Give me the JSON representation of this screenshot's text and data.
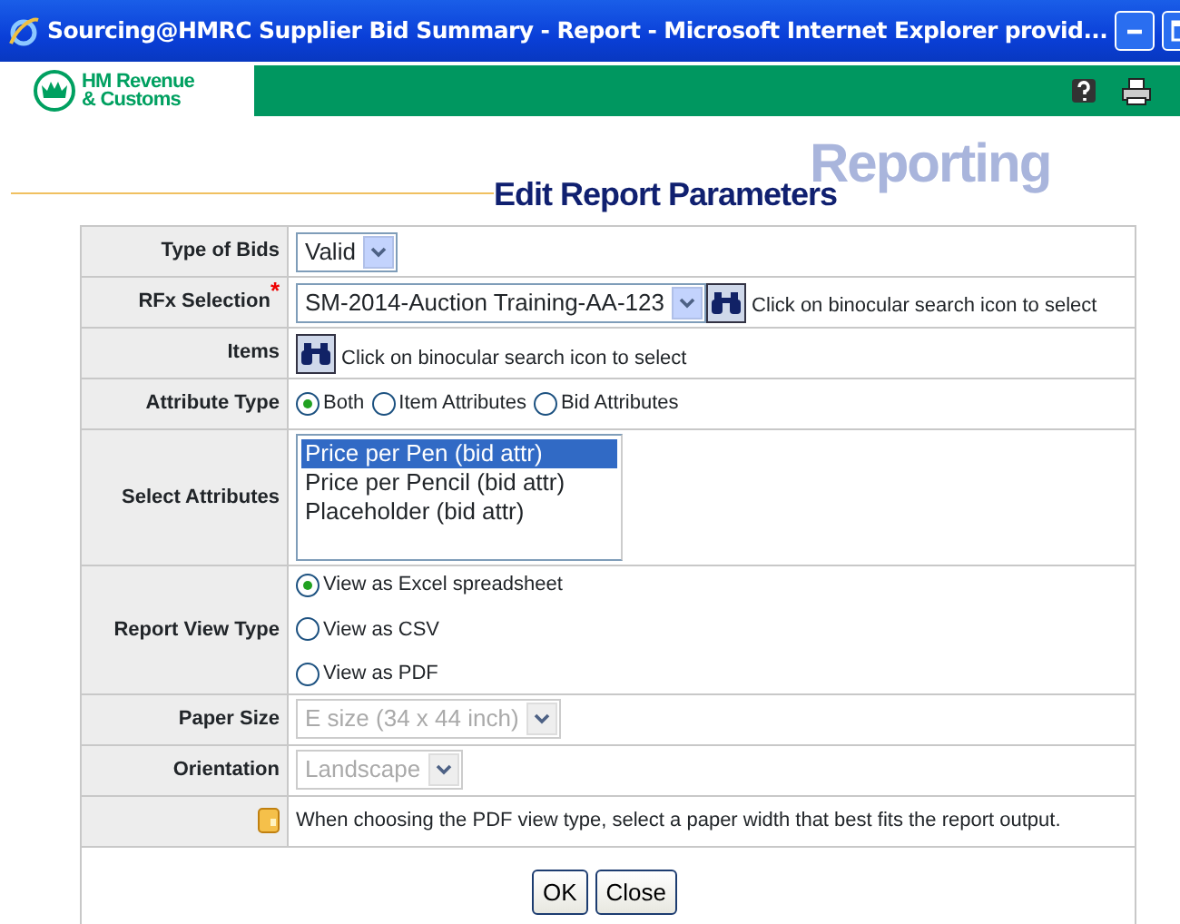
{
  "window": {
    "title": "Sourcing@HMRC Supplier Bid Summary - Report - Microsoft Internet Explorer provid..."
  },
  "header": {
    "logo_lines": [
      "HM Revenue",
      "& Customs"
    ]
  },
  "page": {
    "section": "Reporting",
    "heading": "Edit Report Parameters"
  },
  "form": {
    "rows": [
      {
        "kind": "select",
        "label": "Type of Bids",
        "value": "Valid",
        "disabled": false
      },
      {
        "kind": "select",
        "label": "RFx Selection",
        "required_mark": "*",
        "value": "SM-2014-Auction Training-AA-123",
        "disabled": false,
        "search_hint": "Click on binocular search icon to select"
      },
      {
        "kind": "search",
        "label": "Items",
        "search_hint": "Click on binocular search icon to select"
      },
      {
        "kind": "radios",
        "label": "Attribute Type",
        "options": [
          {
            "label": "Both",
            "selected": true
          },
          {
            "label": "Item Attributes",
            "selected": false
          },
          {
            "label": "Bid Attributes",
            "selected": false
          }
        ]
      },
      {
        "kind": "listbox",
        "label": "Select Attributes",
        "options": [
          {
            "label": "Price per Pen (bid attr)",
            "selected": true
          },
          {
            "label": "Price per Pencil (bid attr)",
            "selected": false
          },
          {
            "label": "Placeholder (bid attr)",
            "selected": false
          }
        ]
      },
      {
        "kind": "radios_stacked",
        "label": "Report View Type",
        "options": [
          {
            "label": "View as Excel spreadsheet",
            "selected": true
          },
          {
            "label": "View as CSV",
            "selected": false
          },
          {
            "label": "View as PDF",
            "selected": false
          }
        ]
      },
      {
        "kind": "select",
        "label": "Paper Size",
        "value": "E size (34 x 44 inch)",
        "disabled": true
      },
      {
        "kind": "select",
        "label": "Orientation",
        "value": "Landscape",
        "disabled": true
      },
      {
        "kind": "note",
        "text": "When choosing the PDF view type, select a paper width that best fits the report output."
      }
    ]
  },
  "buttons": [
    "OK",
    "Close"
  ]
}
